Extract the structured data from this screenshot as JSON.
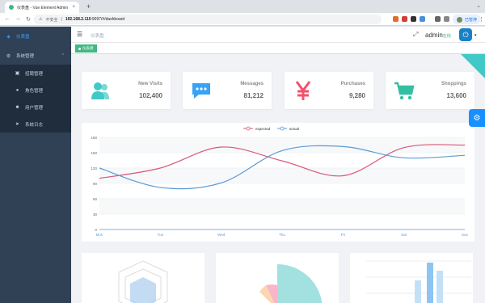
{
  "browser": {
    "tab_title": "仪表盘 - Vue Element Admin",
    "url_security": "不安全",
    "url_host": "192.168.2.110",
    "url_path": ":9097/#/dashboard",
    "profile_label": "已暂停",
    "profile_initial": "F"
  },
  "sidebar": {
    "items": [
      {
        "label": "仪表盘",
        "icon": "dashboard-icon"
      },
      {
        "label": "系统管理",
        "icon": "settings-icon"
      }
    ],
    "subitems": [
      {
        "label": "招聘管理",
        "icon": "briefcase-icon"
      },
      {
        "label": "角色管理",
        "icon": "user-icon"
      },
      {
        "label": "用户管理",
        "icon": "users-icon"
      },
      {
        "label": "系统日志",
        "icon": "send-icon"
      }
    ]
  },
  "navbar": {
    "breadcrumb": "仪表盘",
    "username": "admin",
    "username_suffix": "在线"
  },
  "tags": [
    {
      "label": "仪表盘"
    }
  ],
  "cards": [
    {
      "label": "New Visits",
      "value": "102,400",
      "icon": "users-icon",
      "color": "#40c9c6"
    },
    {
      "label": "Messages",
      "value": "81,212",
      "icon": "message-icon",
      "color": "#36a3f7"
    },
    {
      "label": "Purchases",
      "value": "9,280",
      "icon": "yen-icon",
      "color": "#f4516c"
    },
    {
      "label": "Shoppings",
      "value": "13,600",
      "icon": "shopping-cart-icon",
      "color": "#34bfa3"
    }
  ],
  "chart_data": {
    "type": "line",
    "categories": [
      "Mon",
      "Tue",
      "Wed",
      "Thu",
      "Fri",
      "Sat",
      "Sun"
    ],
    "series": [
      {
        "name": "expected",
        "values": [
          100,
          120,
          161,
          134,
          105,
          160,
          165
        ],
        "color": "#d9567a"
      },
      {
        "name": "actual",
        "values": [
          120,
          82,
          91,
          154,
          162,
          140,
          145
        ],
        "color": "#5b9bd5"
      }
    ],
    "ylim": [
      0,
      180
    ],
    "yticks": [
      "0",
      "30",
      "60",
      "90",
      "120",
      "150",
      "180"
    ],
    "grid": true,
    "legend": "top-center"
  }
}
